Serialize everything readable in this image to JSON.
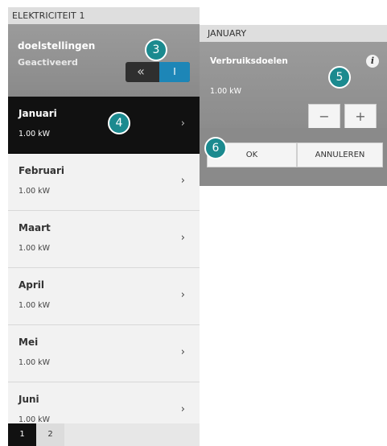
{
  "left_panel": {
    "header_title": "ELEKTRICITEIT 1",
    "goal_title": "doelstellingen",
    "goal_status": "Geactiveerd",
    "toggle_off_glyph": "«",
    "toggle_on_glyph": "I",
    "months": [
      {
        "name": "Januari",
        "value": "1.00 kW",
        "active": true
      },
      {
        "name": "Februari",
        "value": "1.00 kW",
        "active": false
      },
      {
        "name": "Maart",
        "value": "1.00 kW",
        "active": false
      },
      {
        "name": "April",
        "value": "1.00 kW",
        "active": false
      },
      {
        "name": "Mei",
        "value": "1.00 kW",
        "active": false
      },
      {
        "name": "Juni",
        "value": "1.00 kW",
        "active": false
      }
    ],
    "chevron_glyph": "›",
    "pages": [
      "1",
      "2"
    ]
  },
  "right_panel": {
    "header_title": "JANUARY",
    "goal_label": "Verbruiksdoelen",
    "info_glyph": "i",
    "value": "1.00 kW",
    "minus_glyph": "−",
    "plus_glyph": "+",
    "ok_label": "OK",
    "cancel_label": "ANNULEREN"
  },
  "markers": [
    "3",
    "4",
    "5",
    "6"
  ],
  "colors": {
    "accent": "#1d86b7",
    "marker": "#1b8a8f",
    "active_row": "#111111",
    "panel_gray": "#8c8c8c"
  }
}
